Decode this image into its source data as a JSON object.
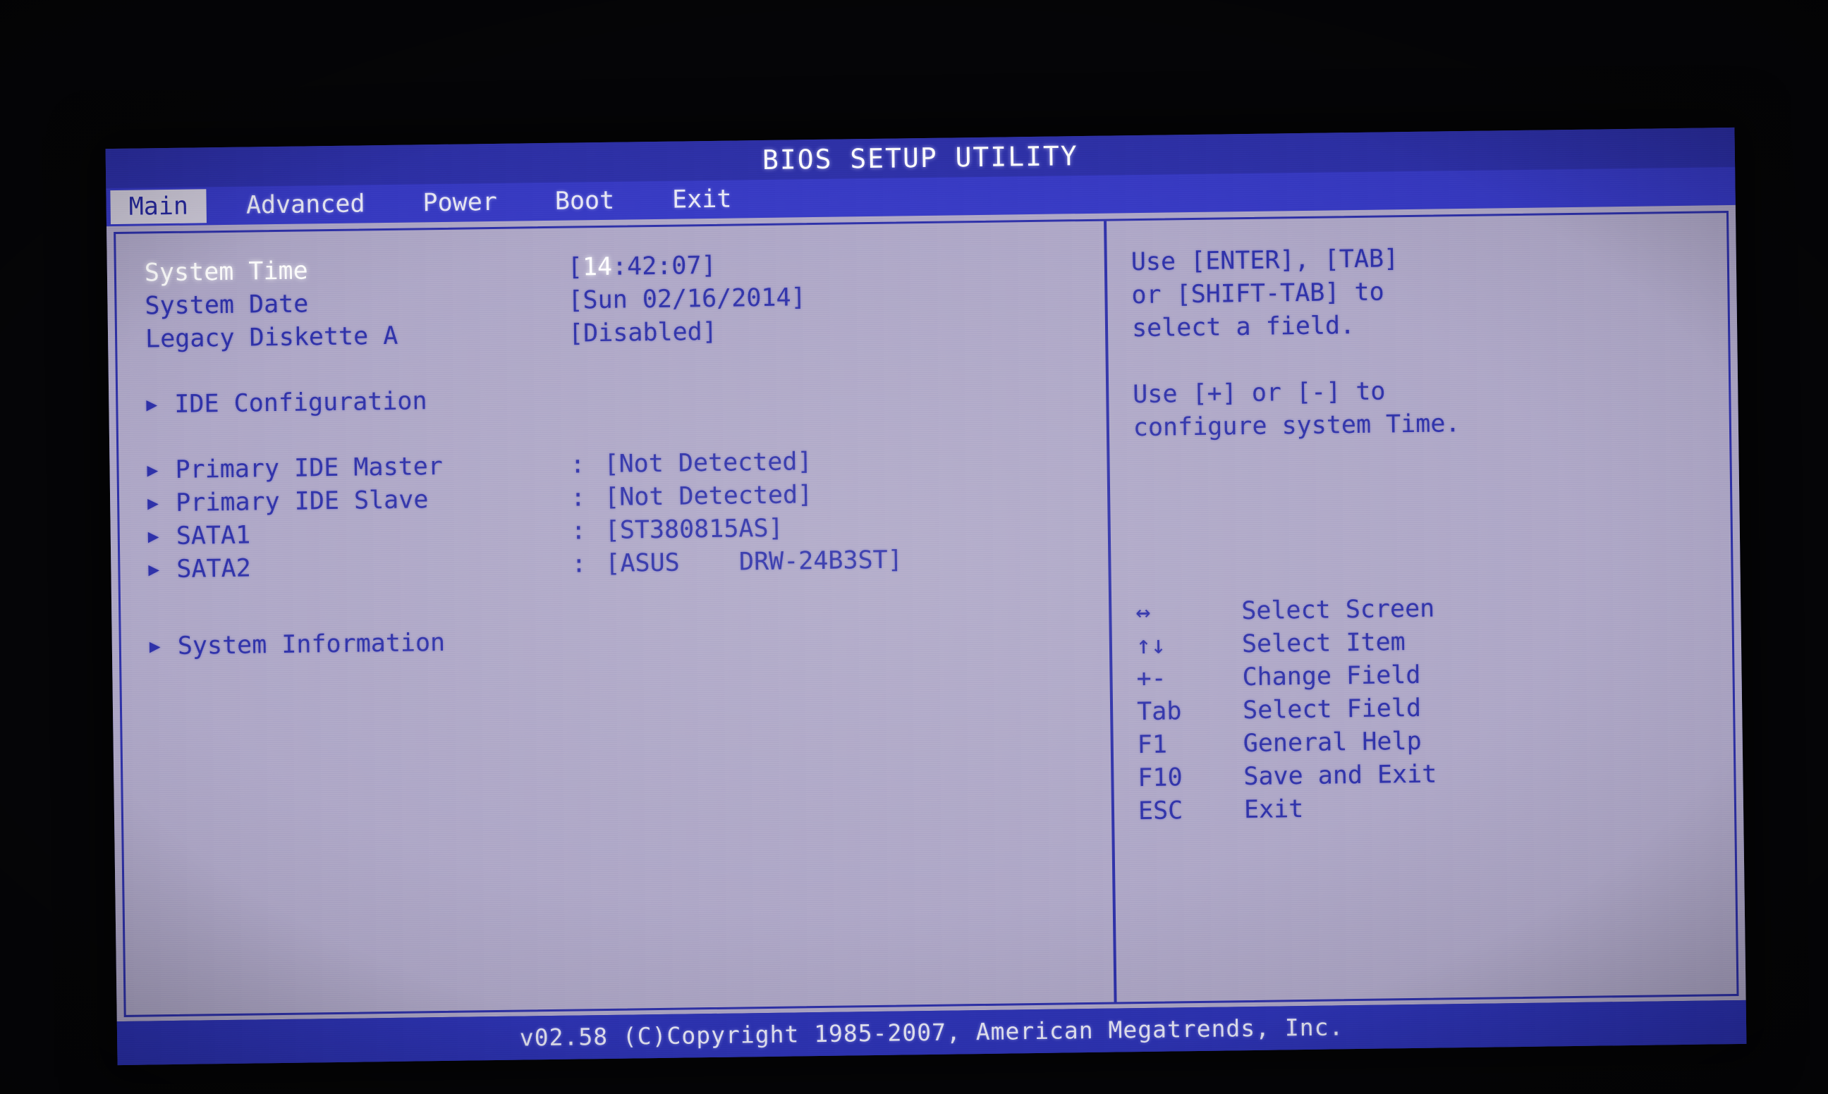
{
  "title": "BIOS SETUP UTILITY",
  "menu": {
    "tabs": [
      {
        "label": "Main",
        "selected": true
      },
      {
        "label": "Advanced",
        "selected": false
      },
      {
        "label": "Power",
        "selected": false
      },
      {
        "label": "Boot",
        "selected": false
      },
      {
        "label": "Exit",
        "selected": false
      }
    ]
  },
  "settings": {
    "system_time": {
      "label": "System Time",
      "value_prefix": "[",
      "value_cursor": "14",
      "value_rest": ":42:07]",
      "active": true
    },
    "system_date": {
      "label": "System Date",
      "value": "[Sun 02/16/2014]"
    },
    "legacy_diskette": {
      "label": "Legacy Diskette A",
      "value": "[Disabled]"
    },
    "ide_configuration": {
      "label": "IDE Configuration",
      "arrow": "submenu-arrow-icon"
    },
    "drives": [
      {
        "label": "Primary IDE Master",
        "colon": ":",
        "value": "[Not Detected]"
      },
      {
        "label": "Primary IDE Slave",
        "colon": ":",
        "value": "[Not Detected]"
      },
      {
        "label": "SATA1",
        "colon": ":",
        "value": "[ST380815AS]"
      },
      {
        "label": "SATA2",
        "colon": ":",
        "value": "[ASUS    DRW-24B3ST]"
      }
    ],
    "system_information": {
      "label": "System Information",
      "arrow": "submenu-arrow-icon"
    }
  },
  "help": {
    "paragraphs": [
      [
        "Use [ENTER], [TAB]",
        "or [SHIFT-TAB] to",
        "select a field."
      ],
      [
        "Use [+] or [-] to",
        "configure system Time."
      ]
    ],
    "legend": [
      {
        "key": "↔",
        "desc": "Select Screen",
        "icon": "left-right-arrow-icon"
      },
      {
        "key": "↑↓",
        "desc": "Select Item",
        "icon": "up-down-arrow-icon"
      },
      {
        "key": "+-",
        "desc": "Change Field",
        "icon": "plus-minus-icon"
      },
      {
        "key": "Tab",
        "desc": "Select Field",
        "icon": "tab-key-icon"
      },
      {
        "key": "F1",
        "desc": "General Help",
        "icon": "f1-key-icon"
      },
      {
        "key": "F10",
        "desc": "Save and Exit",
        "icon": "f10-key-icon"
      },
      {
        "key": "ESC",
        "desc": "Exit",
        "icon": "esc-key-icon"
      }
    ]
  },
  "footer": {
    "text": "v02.58 (C)Copyright 1985-2007, American Megatrends, Inc."
  },
  "colors": {
    "screen_blue": "#2b2ea8",
    "bar_blue": "#3538c4",
    "panel_bg": "#ada6c6",
    "selected_tab_bg": "#cfcada",
    "text_white": "#ffffff"
  }
}
